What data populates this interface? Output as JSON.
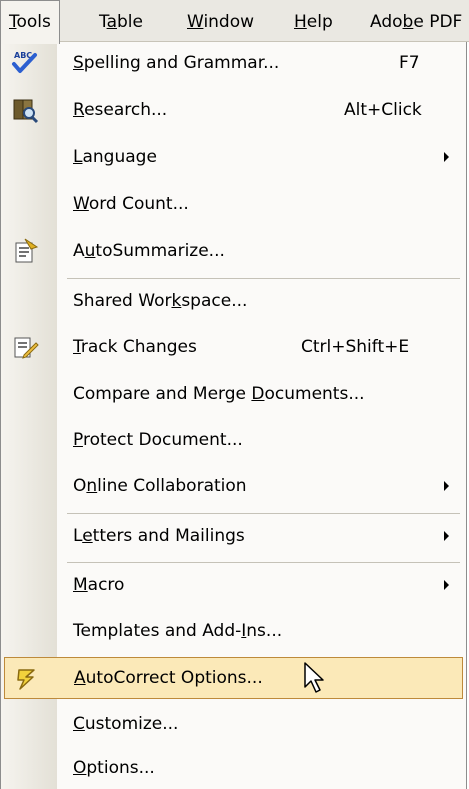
{
  "menubar": {
    "items": [
      {
        "label": "Tools",
        "mn": "T",
        "pre": "",
        "post": "ools"
      },
      {
        "label": "Table",
        "pre": "T",
        "mn": "a",
        "post": "ble"
      },
      {
        "label": "Window",
        "pre": "",
        "mn": "W",
        "post": "indow"
      },
      {
        "label": "Help",
        "pre": "",
        "mn": "H",
        "post": "elp"
      },
      {
        "label": "Adobe PDF",
        "pre": "Ado",
        "mn": "b",
        "post": "e PDF"
      }
    ]
  },
  "menu": {
    "items": [
      {
        "label": "Spelling and Grammar...",
        "pre": "",
        "mn": "S",
        "post": "pelling and Grammar...",
        "shortcut": "F7",
        "icon": "spelling-check-icon"
      },
      {
        "label": "Research...",
        "pre": "",
        "mn": "R",
        "post": "esearch...",
        "shortcut": "Alt+Click",
        "icon": "research-book-icon"
      },
      {
        "label": "Language",
        "pre": "",
        "mn": "L",
        "post": "anguage",
        "submenu": true
      },
      {
        "label": "Word Count...",
        "pre": "",
        "mn": "W",
        "post": "ord Count..."
      },
      {
        "label": "AutoSummarize...",
        "pre": "A",
        "mn": "u",
        "post": "toSummarize...",
        "icon": "autosummarize-icon"
      },
      {
        "label": "Shared Workspace...",
        "pre": "Shared Wor",
        "mn": "k",
        "post": "space..."
      },
      {
        "label": "Track Changes",
        "pre": "",
        "mn": "T",
        "post": "rack Changes",
        "shortcut": "Ctrl+Shift+E",
        "icon": "track-changes-icon"
      },
      {
        "label": "Compare and Merge Documents...",
        "pre": "Compare and Merge ",
        "mn": "D",
        "post": "ocuments..."
      },
      {
        "label": "Protect Document...",
        "pre": "",
        "mn": "P",
        "post": "rotect Document..."
      },
      {
        "label": "Online Collaboration",
        "pre": "O",
        "mn": "n",
        "post": "line Collaboration",
        "submenu": true
      },
      {
        "label": "Letters and Mailings",
        "pre": "L",
        "mn": "e",
        "post": "tters and Mailings",
        "submenu": true
      },
      {
        "label": "Macro",
        "pre": "",
        "mn": "M",
        "post": "acro",
        "submenu": true
      },
      {
        "label": "Templates and Add-Ins...",
        "pre": "Templates and Add-",
        "mn": "I",
        "post": "ns..."
      },
      {
        "label": "AutoCorrect Options...",
        "pre": "",
        "mn": "A",
        "post": "utoCorrect Options...",
        "icon": "autocorrect-lightning-icon",
        "highlighted": true
      },
      {
        "label": "Customize...",
        "pre": "",
        "mn": "C",
        "post": "ustomize..."
      },
      {
        "label": "Options...",
        "pre": "",
        "mn": "O",
        "post": "ptions..."
      }
    ]
  },
  "colors": {
    "menubar_bg": "#eae8e2",
    "menu_bg": "#fbfaf8",
    "highlight_bg": "#fbe9b8",
    "highlight_border": "#bd8a3b"
  }
}
